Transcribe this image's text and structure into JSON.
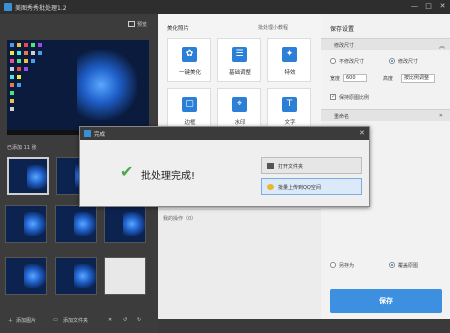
{
  "app": {
    "title": "美图秀秀批处理1.2",
    "window_buttons": [
      "—",
      "□",
      "✕"
    ]
  },
  "left_panel": {
    "preview_label": "预览",
    "count_label": "已添加 11 张",
    "bottom_actions": {
      "add_image": "添加图片",
      "add_folder": "添加文件夹"
    }
  },
  "middle_panel": {
    "heading": "美化照片",
    "heading_right": "批处理小教程",
    "tools": [
      {
        "label": "一键美化",
        "icon": "✿"
      },
      {
        "label": "基础调整",
        "icon": "☰"
      },
      {
        "label": "特效",
        "icon": "✦"
      },
      {
        "label": "边框",
        "icon": "▢"
      },
      {
        "label": "水印",
        "icon": "⌖"
      },
      {
        "label": "文字",
        "icon": "T"
      }
    ],
    "history_label": "我的操作（0）"
  },
  "right_panel": {
    "heading": "保存设置",
    "section_size": "修改尺寸",
    "radio_keep": "不修改尺寸",
    "radio_modify": "修改尺寸",
    "width_label": "宽度",
    "width_value": "600",
    "height_label": "高度",
    "height_mode": "按比例调整",
    "keep_ratio_label": "保持原图比例",
    "section_rename": "重命名",
    "save_as_label": "另存为",
    "overwrite_label": "覆盖原图",
    "save_button": "保存"
  },
  "modal": {
    "title": "完成",
    "message": "批处理完成!",
    "open_folder": "打开文件夹",
    "upload_qq": "批量上传到QQ空间"
  },
  "colors": {
    "accent": "#3d8fe0",
    "success": "#4aa84a"
  }
}
